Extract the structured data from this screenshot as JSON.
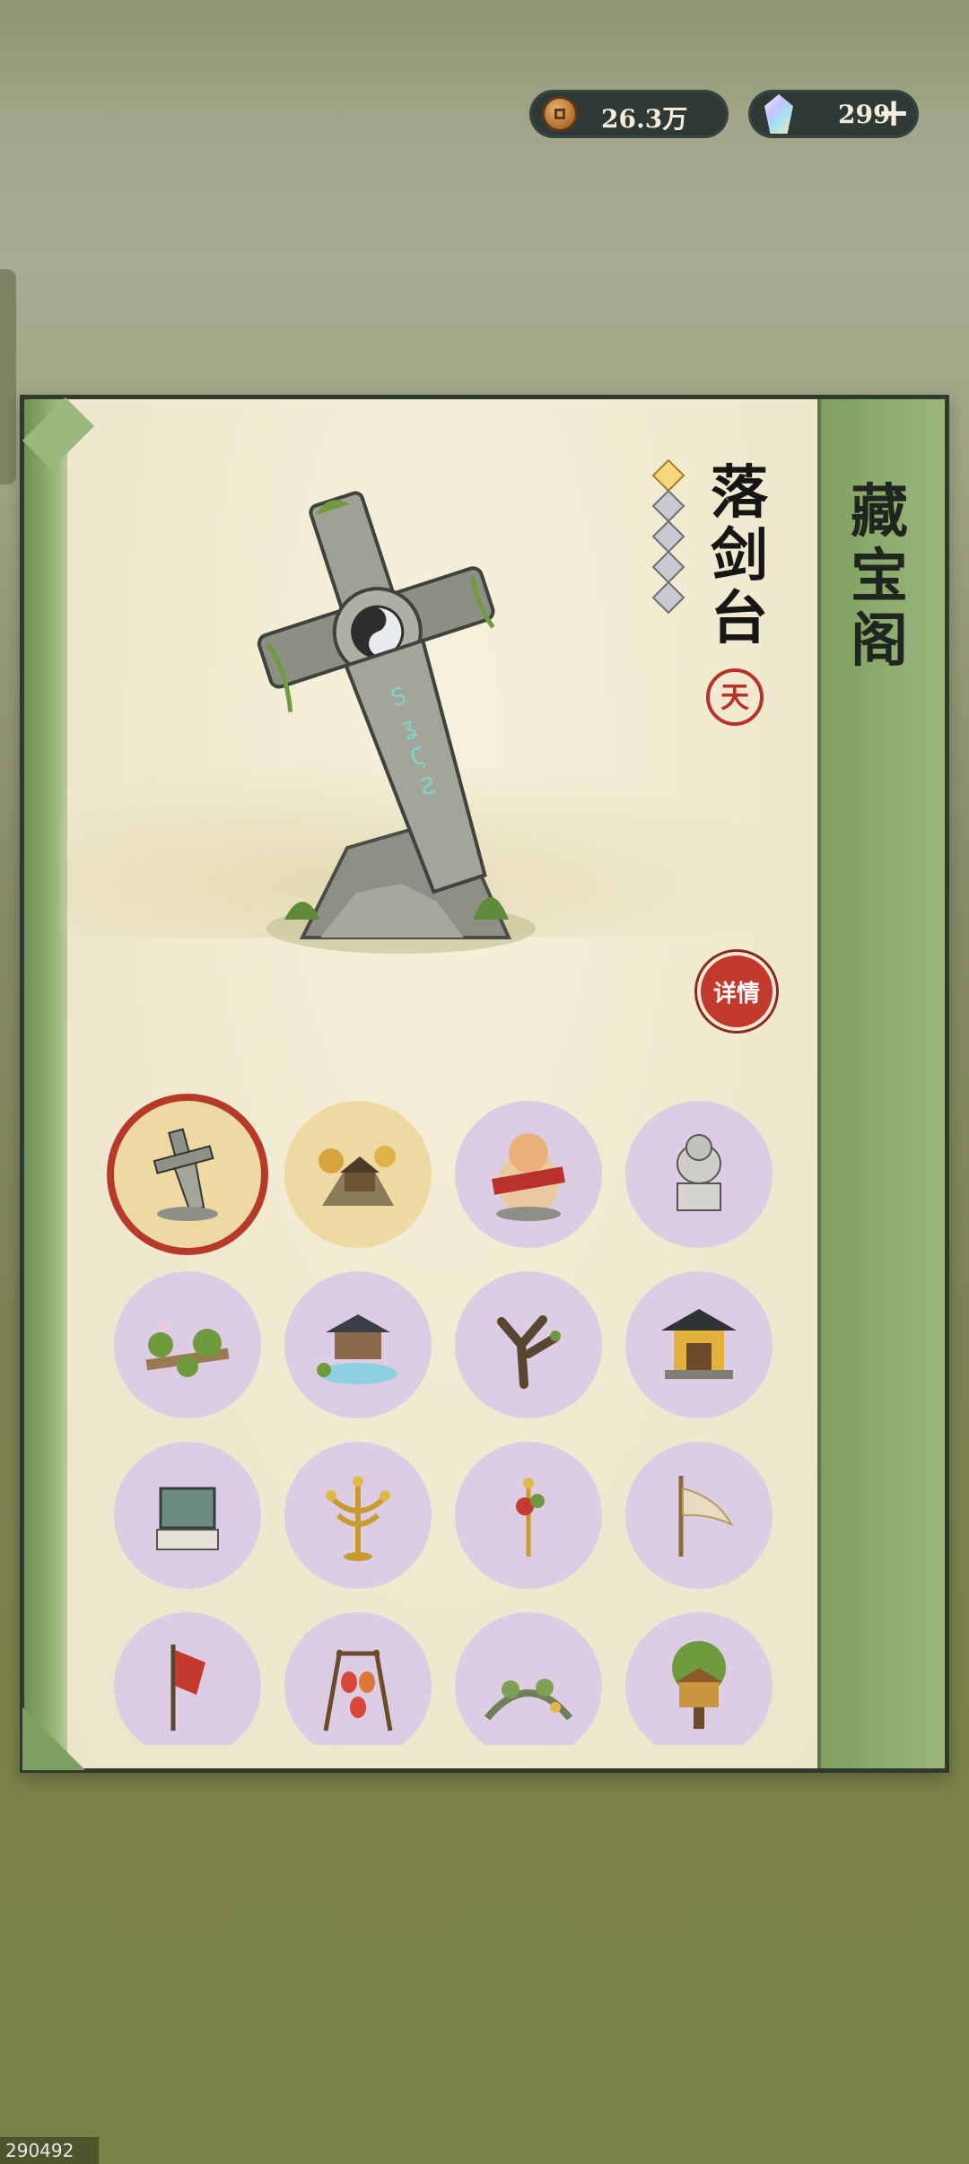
{
  "currency": {
    "coins": "26.3万",
    "gems": "299",
    "plus_label": "+"
  },
  "panel": {
    "title": "藏宝阁",
    "item_name": "落剑台",
    "grade": "天",
    "detail_label": "详情",
    "stars_total": 5,
    "stars_filled": 1
  },
  "items": [
    {
      "icon": "sword-monument-icon",
      "style": "selected"
    },
    {
      "icon": "mountain-hut-icon",
      "style": "gold"
    },
    {
      "icon": "tiger-banner-icon",
      "style": "purple"
    },
    {
      "icon": "stone-lion-icon",
      "style": "purple"
    },
    {
      "icon": "lotus-bridge-icon",
      "style": "purple"
    },
    {
      "icon": "water-pavilion-icon",
      "style": "purple"
    },
    {
      "icon": "old-tree-icon",
      "style": "purple"
    },
    {
      "icon": "shrine-icon",
      "style": "purple"
    },
    {
      "icon": "bronze-cauldron-icon",
      "style": "purple"
    },
    {
      "icon": "gold-candelabra-icon",
      "style": "purple"
    },
    {
      "icon": "flower-lamp-icon",
      "style": "purple"
    },
    {
      "icon": "banner-pole-icon",
      "style": "purple"
    },
    {
      "icon": "red-flag-icon",
      "style": "purple"
    },
    {
      "icon": "lantern-rack-icon",
      "style": "purple"
    },
    {
      "icon": "vine-arch-icon",
      "style": "purple"
    },
    {
      "icon": "treehouse-icon",
      "style": "purple"
    }
  ],
  "watermark": "290492"
}
